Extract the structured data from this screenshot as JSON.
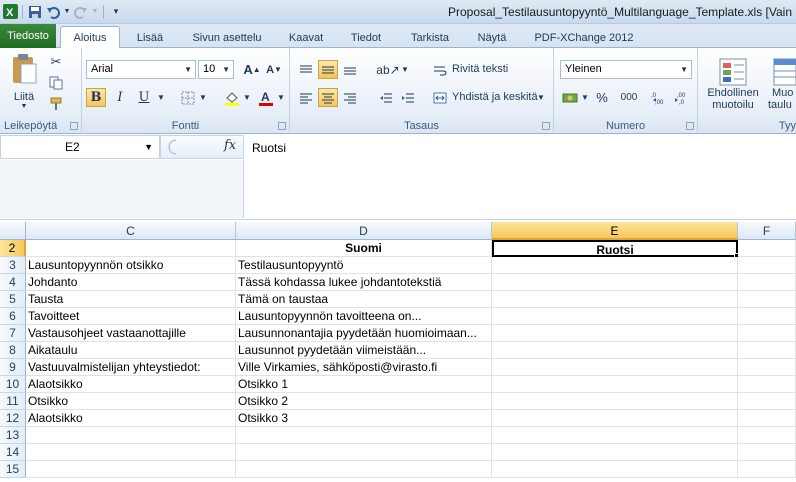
{
  "titlebar": {
    "document_title": "Proposal_Testilausuntopyyntö_Multilanguage_Template.xls  [Vain"
  },
  "tabs": [
    "Tiedosto",
    "Aloitus",
    "Lisää",
    "Sivun asettelu",
    "Kaavat",
    "Tiedot",
    "Tarkista",
    "Näytä",
    "PDF-XChange 2012"
  ],
  "ribbon": {
    "clipboard": {
      "paste_label": "Liitä",
      "group_label": "Leikepöytä"
    },
    "font": {
      "name": "Arial",
      "size": "10",
      "group_label": "Fontti",
      "bold": "B",
      "italic": "I",
      "underline": "U"
    },
    "alignment": {
      "wrap_text": "Rivitä teksti",
      "merge_center": "Yhdistä ja keskitä",
      "group_label": "Tasaus"
    },
    "number": {
      "format": "Yleinen",
      "percent": "%",
      "thousands": "000",
      "group_label": "Numero"
    },
    "styles": {
      "conditional_line1": "Ehdollinen",
      "conditional_line2": "muotoilu",
      "table_line1": "Muo",
      "table_line2": "taulu",
      "group_partial": "Tyy"
    }
  },
  "formula_bar": {
    "name_box": "E2",
    "fx": "fx",
    "content": "Ruotsi"
  },
  "grid": {
    "columns": [
      "C",
      "D",
      "E",
      "F"
    ],
    "selected_column": "E",
    "selected_row": "2",
    "rows": [
      {
        "num": "2",
        "C": "",
        "D": "Suomi",
        "E": "Ruotsi"
      },
      {
        "num": "3",
        "C": "Lausuntopyynnön otsikko",
        "D": "Testilausuntopyyntö",
        "E": ""
      },
      {
        "num": "4",
        "C": "Johdanto",
        "D": "Tässä kohdassa lukee johdantotekstiä",
        "E": ""
      },
      {
        "num": "5",
        "C": "Tausta",
        "D": "Tämä on taustaa",
        "E": ""
      },
      {
        "num": "6",
        "C": "Tavoitteet",
        "D": "Lausuntopyynnön tavoitteena on...",
        "E": ""
      },
      {
        "num": "7",
        "C": "Vastausohjeet vastaanottajille",
        "D": "Lausunnonantajia pyydetään huomioimaan...",
        "E": ""
      },
      {
        "num": "8",
        "C": "Aikataulu",
        "D": "Lausunnot pyydetään viimeistään...",
        "E": ""
      },
      {
        "num": "9",
        "C": "Vastuuvalmistelijan yhteystiedot:",
        "D": "Ville Virkamies, sähköposti@virasto.fi",
        "E": ""
      },
      {
        "num": "10",
        "C": "Alaotsikko",
        "D": "Otsikko 1",
        "E": ""
      },
      {
        "num": "11",
        "C": "Otsikko",
        "D": "Otsikko 2",
        "E": ""
      },
      {
        "num": "12",
        "C": "Alaotsikko",
        "D": "Otsikko 3",
        "E": ""
      },
      {
        "num": "13",
        "C": "",
        "D": "",
        "E": ""
      },
      {
        "num": "14",
        "C": "",
        "D": "",
        "E": ""
      },
      {
        "num": "15",
        "C": "",
        "D": "",
        "E": ""
      }
    ]
  }
}
